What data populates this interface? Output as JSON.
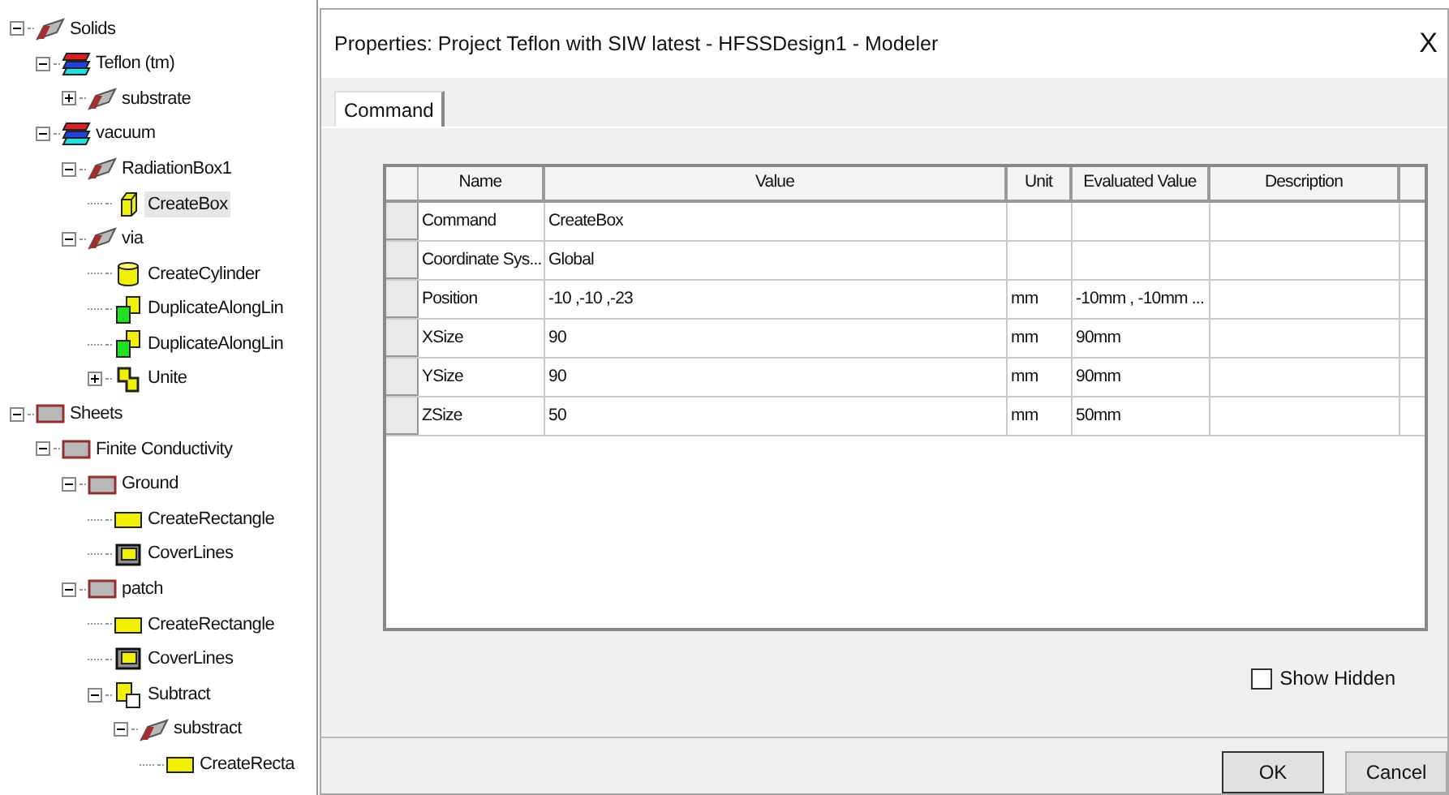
{
  "tree": [
    {
      "label": "Solids",
      "kind": "solid",
      "expanded": true,
      "selected": false,
      "children": [
        {
          "label": "Teflon (tm)",
          "kind": "material",
          "expanded": true,
          "selected": false,
          "children": [
            {
              "label": "substrate",
              "kind": "solid",
              "expanded": false,
              "selected": false
            }
          ]
        },
        {
          "label": "vacuum",
          "kind": "material",
          "expanded": true,
          "selected": false,
          "children": [
            {
              "label": "RadiationBox1",
              "kind": "solid",
              "expanded": true,
              "selected": false,
              "children": [
                {
                  "label": "CreateBox",
                  "kind": "box",
                  "selected": true
                }
              ]
            },
            {
              "label": "via",
              "kind": "solid",
              "expanded": true,
              "selected": false,
              "children": [
                {
                  "label": "CreateCylinder",
                  "kind": "cylinder",
                  "selected": false
                },
                {
                  "label": "DuplicateAlongLin",
                  "kind": "duplicate",
                  "selected": false
                },
                {
                  "label": "DuplicateAlongLin",
                  "kind": "duplicate",
                  "selected": false
                },
                {
                  "label": "Unite",
                  "kind": "unite",
                  "expanded": false,
                  "selected": false
                }
              ]
            }
          ]
        }
      ]
    },
    {
      "label": "Sheets",
      "kind": "sheet",
      "expanded": true,
      "selected": false,
      "children": [
        {
          "label": "Finite Conductivity",
          "kind": "sheet",
          "expanded": true,
          "selected": false,
          "children": [
            {
              "label": "Ground",
              "kind": "sheet",
              "expanded": true,
              "selected": false,
              "children": [
                {
                  "label": "CreateRectangle",
                  "kind": "rect",
                  "selected": false
                },
                {
                  "label": "CoverLines",
                  "kind": "cover",
                  "selected": false
                }
              ]
            },
            {
              "label": "patch",
              "kind": "sheet",
              "expanded": true,
              "selected": false,
              "children": [
                {
                  "label": "CreateRectangle",
                  "kind": "rect",
                  "selected": false
                },
                {
                  "label": "CoverLines",
                  "kind": "cover",
                  "selected": false
                },
                {
                  "label": "Subtract",
                  "kind": "subtract",
                  "expanded": true,
                  "selected": false,
                  "children": [
                    {
                      "label": "substract",
                      "kind": "solid",
                      "expanded": true,
                      "selected": false,
                      "children": [
                        {
                          "label": "CreateRecta",
                          "kind": "rect",
                          "selected": false
                        }
                      ]
                    }
                  ]
                }
              ]
            }
          ]
        }
      ]
    }
  ],
  "dialog": {
    "title": "Properties: Project Teflon with SIW latest - HFSSDesign1 - Modeler",
    "close": "X",
    "tabs": [
      {
        "label": "Command",
        "selected": true
      }
    ],
    "table": {
      "columns": [
        "Name",
        "Value",
        "Unit",
        "Evaluated Value",
        "Description"
      ],
      "rows": [
        [
          "Command",
          "CreateBox",
          "",
          "",
          ""
        ],
        [
          "Coordinate Sys...",
          "Global",
          "",
          "",
          ""
        ],
        [
          "Position",
          "-10 ,-10 ,-23",
          "mm",
          "-10mm , -10mm ...",
          ""
        ],
        [
          "XSize",
          "90",
          "mm",
          "90mm",
          ""
        ],
        [
          "YSize",
          "90",
          "mm",
          "90mm",
          ""
        ],
        [
          "ZSize",
          "50",
          "mm",
          "50mm",
          ""
        ]
      ]
    },
    "show_hidden": {
      "label": "Show Hidden",
      "checked": false
    },
    "buttons": [
      "OK",
      "Cancel"
    ]
  }
}
